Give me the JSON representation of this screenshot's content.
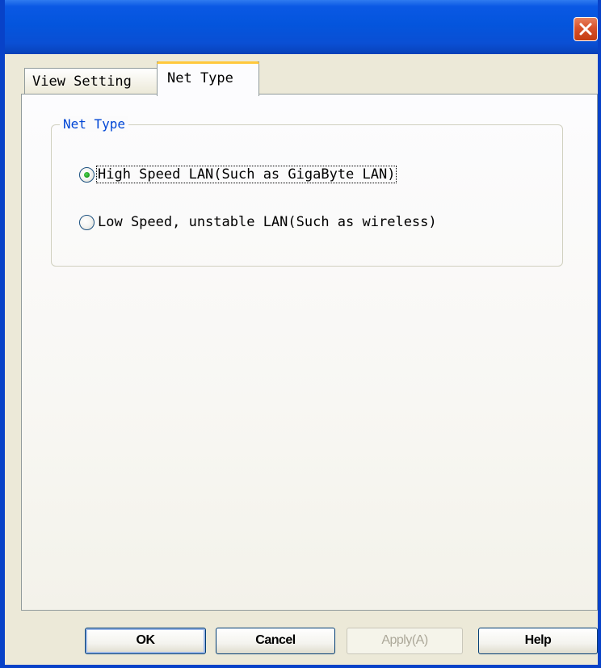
{
  "window": {
    "title": "",
    "close_icon": "close-icon"
  },
  "tabs": [
    {
      "label": "View Setting",
      "selected": false
    },
    {
      "label": "Net Type",
      "selected": true
    }
  ],
  "net_type_group": {
    "title": "Net Type",
    "options": [
      {
        "label": "High Speed LAN(Such as GigaByte LAN)",
        "checked": true,
        "focused": true
      },
      {
        "label": "Low Speed, unstable LAN(Such as wireless)",
        "checked": false,
        "focused": false
      }
    ]
  },
  "buttons": {
    "ok": "OK",
    "cancel": "Cancel",
    "apply": "Apply(A)",
    "apply_enabled": false,
    "help": "Help"
  },
  "colors": {
    "titlebar": "#0455dd",
    "close_button": "#d8512a",
    "group_title": "#0046d5",
    "selected_tab_accent": "#ffc83c",
    "radio_checked": "#21a121"
  }
}
